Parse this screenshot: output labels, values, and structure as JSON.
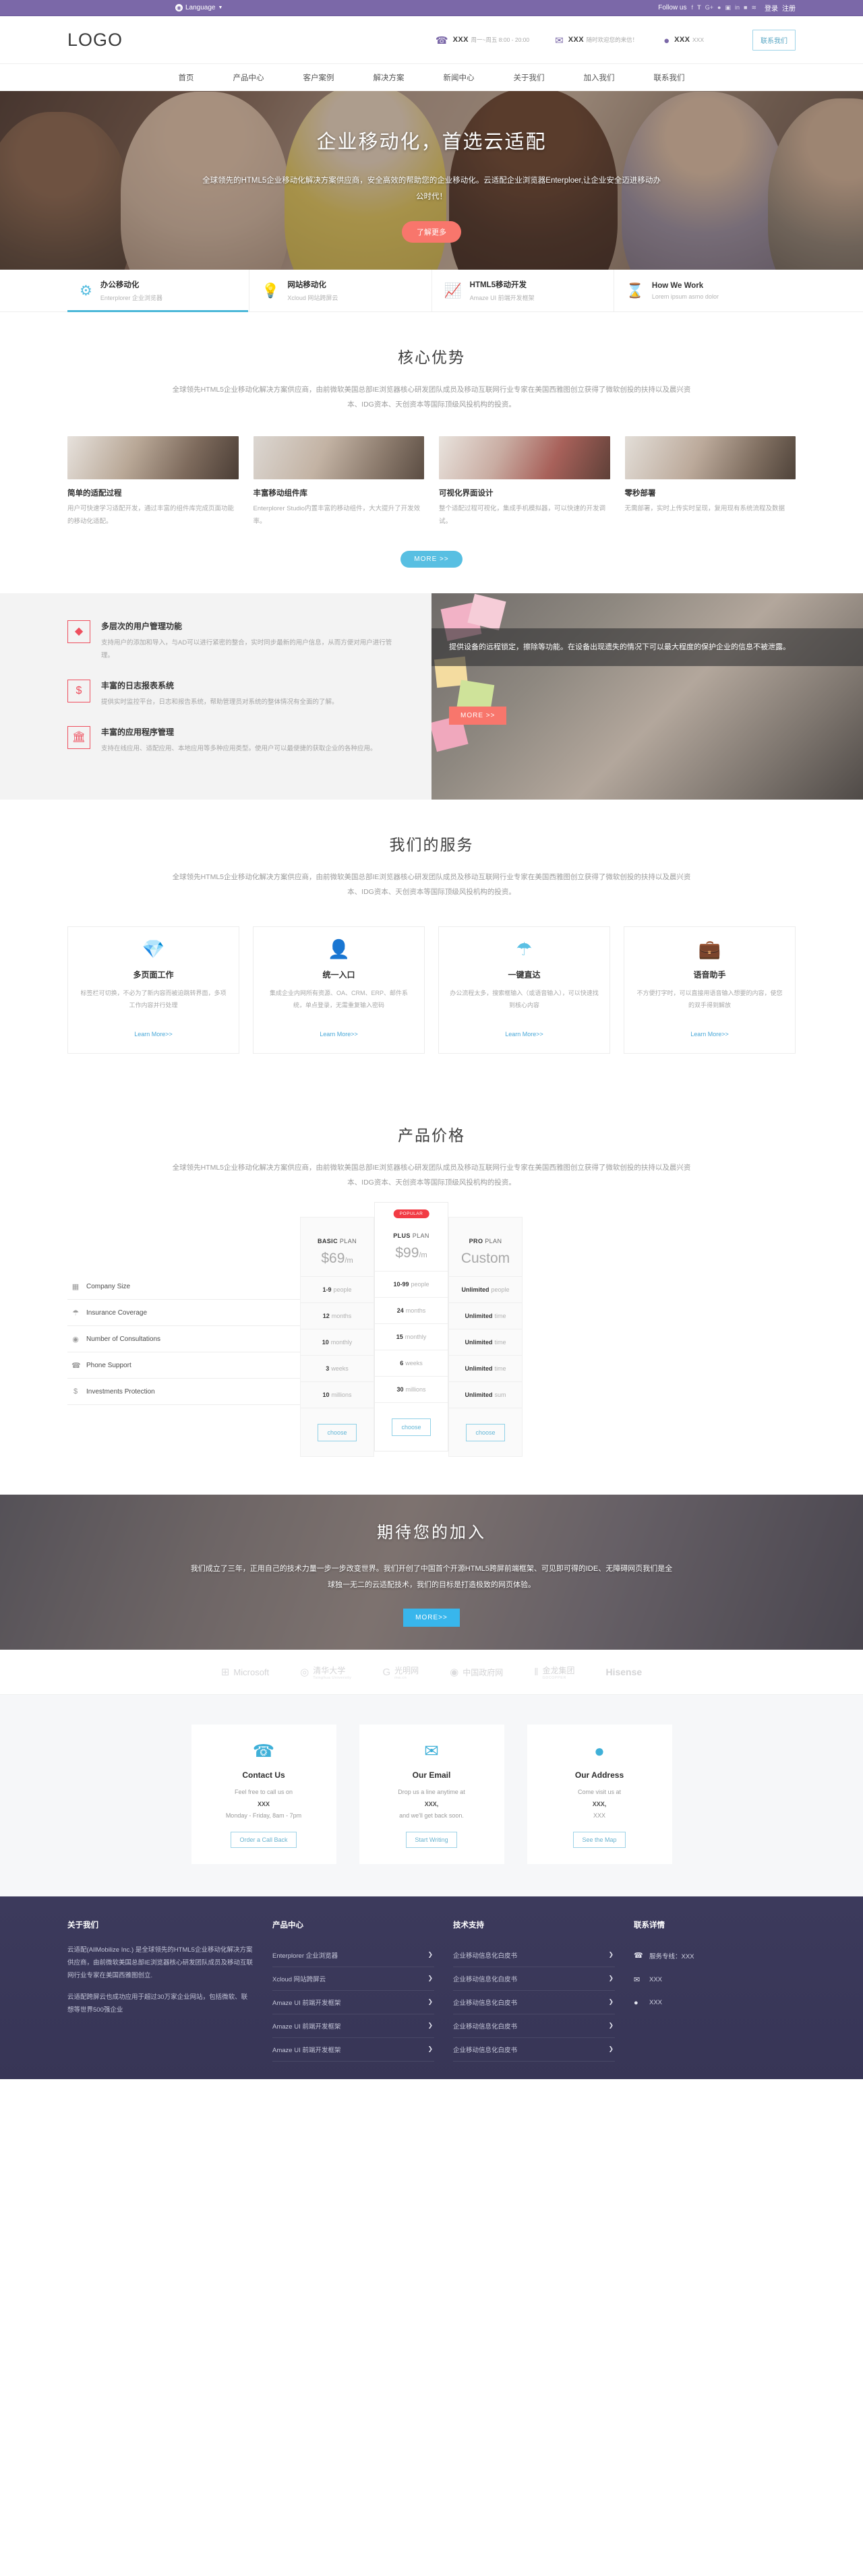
{
  "topbar": {
    "language_label": "Language",
    "globe_icon": "globe-icon",
    "follow_label": "Follow us",
    "socials": [
      "f",
      "𝐓",
      "G+",
      "●",
      "▣",
      "in",
      "■",
      "≋"
    ],
    "login_label": "登录",
    "register_label": "注册"
  },
  "header": {
    "logo": "LOGO",
    "contacts": [
      {
        "icon": "phone-icon",
        "title": "XXX",
        "sub": "周一~周五 8:00 - 20:00"
      },
      {
        "icon": "mail-icon",
        "title": "XXX",
        "sub": "随时欢迎您的来信！"
      },
      {
        "icon": "location-icon",
        "title": "XXX",
        "sub": "XXX"
      }
    ],
    "contact_button": "联系我们",
    "nav": [
      "首页",
      "产品中心",
      "客户案例",
      "解决方案",
      "新闻中心",
      "关于我们",
      "加入我们",
      "联系我们"
    ]
  },
  "hero": {
    "title": "企业移动化，首选云适配",
    "desc": "全球领先的HTML5企业移动化解决方案供应商，安全高效的帮助您的企业移动化。云适配企业浏览器Enterploer,让企业安全迈进移动办公时代！",
    "button": "了解更多"
  },
  "feature_tabs": [
    {
      "icon": "gear-icon",
      "title": "办公移动化",
      "sub": "Enterplorer 企业浏览器",
      "active": true
    },
    {
      "icon": "bulb-icon",
      "title": "网站移动化",
      "sub": "Xcloud 网站跨屏云",
      "active": false
    },
    {
      "icon": "chart-icon",
      "title": "HTML5移动开发",
      "sub": "Amaze UI 前端开发框架",
      "active": false
    },
    {
      "icon": "hourglass-icon",
      "title": "How We Work",
      "sub": "Lorem ipsum asmo dolor",
      "active": false
    }
  ],
  "core": {
    "title": "核心优势",
    "desc": "全球领先HTML5企业移动化解决方案供应商，由前微软美国总部IE浏览器核心研发团队成员及移动互联网行业专家在美国西雅图创立获得了微软创投的扶持以及晨兴资本、IDG资本、天创资本等国际顶级风投机构的投资。",
    "cards": [
      {
        "title": "简单的适配过程",
        "text": "用户可快速学习适配开发，通过丰富的组件库完成页面功能的移动化适配。"
      },
      {
        "title": "丰富移动组件库",
        "text": "Enterplorer Studio内置丰富的移动组件，大大提升了开发效率。"
      },
      {
        "title": "可视化界面设计",
        "text": "整个适配过程可视化，集成手机模拟器，可以快速的开发调试。"
      },
      {
        "title": "零秒部署",
        "text": "无需部署，实时上传实时呈现，复用现有系统流程及数据"
      }
    ],
    "more_button": "MORE  >>"
  },
  "split": {
    "features": [
      {
        "icon": "diamond-icon",
        "title": "多层次的用户管理功能",
        "text": "支持用户的添加和导入，与AD可以进行紧密的整合，实时同步最新的用户信息，从而方便对用户进行管理。"
      },
      {
        "icon": "dollar-icon",
        "title": "丰富的日志报表系统",
        "text": "提供实时监控平台，日志和报告系统，帮助管理员对系统的整体情况有全面的了解。"
      },
      {
        "icon": "bank-icon",
        "title": "丰富的应用程序管理",
        "text": "支持在线应用、适配应用、本地应用等多种应用类型。使用户可以最便捷的获取企业的各种应用。"
      }
    ],
    "panel_text": "提供设备的远程锁定，擦除等功能。在设备出现遗失的情况下可以最大程度的保护企业的信息不被泄露。",
    "more_button": "MORE  >>"
  },
  "services": {
    "title": "我们的服务",
    "desc": "全球领先HTML5企业移动化解决方案供应商，由前微软美国总部IE浏览器核心研发团队成员及移动互联网行业专家在美国西雅图创立获得了微软创投的扶持以及晨兴资本、IDG资本、天创资本等国际顶级风投机构的投资。",
    "cards": [
      {
        "icon": "diamond-icon",
        "title": "多页面工作",
        "text": "标签栏可切换，不必为了新内容而被迫跳转界面，多项工作内容并行处理",
        "link": "Learn More>>"
      },
      {
        "icon": "user-icon",
        "title": "统一入口",
        "text": "集成企业内网所有资源、OA、CRM、ERP、邮件系统，单点登录，无需重复输入密码",
        "link": "Learn More>>"
      },
      {
        "icon": "umbrella-icon",
        "title": "一键直达",
        "text": "办公流程太多，搜索框输入（或语音输入），可以快速找到核心内容",
        "link": "Learn More>>"
      },
      {
        "icon": "briefcase-icon",
        "title": "语音助手",
        "text": "不方便打字时，可以直接用语音输入想要的内容，使您的双手得到解放",
        "link": "Learn More>>"
      }
    ]
  },
  "pricing": {
    "title": "产品价格",
    "desc": "全球领先HTML5企业移动化解决方案供应商，由前微软美国总部IE浏览器核心研发团队成员及移动互联网行业专家在美国西雅图创立获得了微软创投的扶持以及晨兴资本、IDG资本、天创资本等国际顶级风投机构的投资。",
    "features": [
      {
        "icon": "building-icon",
        "label": "Company Size"
      },
      {
        "icon": "umbrella-icon",
        "label": "Insurance Coverage"
      },
      {
        "icon": "globe-icon",
        "label": "Number of Consultations"
      },
      {
        "icon": "phone-icon",
        "label": "Phone Support"
      },
      {
        "icon": "dollar-icon",
        "label": "Investments Protection"
      }
    ],
    "popular_badge": "POPULAR",
    "plans": [
      {
        "name_strong": "BASIC",
        "name_rest": " PLAN",
        "price": "$69",
        "per": "/m",
        "popular": false,
        "cells": [
          {
            "strong": "1-9",
            "rest": " people"
          },
          {
            "strong": "12",
            "rest": "months"
          },
          {
            "strong": "10",
            "rest": " monthly"
          },
          {
            "strong": "3",
            "rest": " weeks"
          },
          {
            "strong": "10",
            "rest": " millions"
          }
        ],
        "button": "choose"
      },
      {
        "name_strong": "PLUS",
        "name_rest": " PLAN",
        "price": "$99",
        "per": "/m",
        "popular": true,
        "cells": [
          {
            "strong": "10-99",
            "rest": " people"
          },
          {
            "strong": "24",
            "rest": "months"
          },
          {
            "strong": "15",
            "rest": " monthly"
          },
          {
            "strong": "6",
            "rest": " weeks"
          },
          {
            "strong": "30",
            "rest": " millions"
          }
        ],
        "button": "choose"
      },
      {
        "name_strong": "PRO",
        "name_rest": " PLAN",
        "price": "Custom",
        "per": "",
        "popular": false,
        "cells": [
          {
            "strong": "Unlimited",
            "rest": " people"
          },
          {
            "strong": "Unlimited",
            "rest": " time"
          },
          {
            "strong": "Unlimited",
            "rest": " time"
          },
          {
            "strong": "Unlimited",
            "rest": " time"
          },
          {
            "strong": "Unlimited",
            "rest": " sum"
          }
        ],
        "button": "choose"
      }
    ]
  },
  "join": {
    "title": "期待您的加入",
    "desc": "我们成立了三年，正用自己的技术力量一步一步改变世界。我们开创了中国首个开源HTML5跨屏前端框架、可见即可得的IDE、无障碍网页我们是全球独一无二的云适配技术，我们的目标是打造极致的网页体验。",
    "button": "MORE>>"
  },
  "partners": [
    {
      "name": "Microsoft",
      "mark": "⊞",
      "sub": ""
    },
    {
      "name": "清华大学",
      "mark": "◎",
      "sub": "Tsinghua University"
    },
    {
      "name": "光明网",
      "mark": "G",
      "sub": "mw.cn"
    },
    {
      "name": "中国政府网",
      "mark": "◉",
      "sub": ""
    },
    {
      "name": "金龙集团",
      "mark": "‖",
      "sub": "GDCOPPER"
    },
    {
      "name": "Hisense",
      "mark": "",
      "sub": ""
    }
  ],
  "contact_cards": [
    {
      "icon": "phone-icon",
      "title": "Contact Us",
      "line1": "Feel free to call us on",
      "line2": "XXX",
      "line3": "Monday - Friday, 8am - 7pm",
      "button": "Order a Call Back"
    },
    {
      "icon": "mail-icon",
      "title": "Our Email",
      "line1": "Drop us a line anytime at",
      "line2": "XXX,",
      "line3": "and we'll get back soon.",
      "button": "Start Writing"
    },
    {
      "icon": "location-icon",
      "title": "Our Address",
      "line1": "Come visit us at",
      "line2": "XXX,",
      "line3": "XXX",
      "button": "See the Map"
    }
  ],
  "footer": {
    "about": {
      "title": "关于我们",
      "p1": "云适配(AllMobilize Inc.) 是全球领先的HTML5企业移动化解决方案供应商，由前微软美国总部IE浏览器核心研发团队成员及移动互联网行业专家在美国西雅图创立.",
      "p2": "云适配跨屏云也成功应用于超过30万家企业网站，包括微软、联想等世界500强企业"
    },
    "products": {
      "title": "产品中心",
      "items": [
        "Enterplorer 企业浏览器",
        "Xcloud 网站跨屏云",
        "Amaze UI 前端开发框架",
        "Amaze UI 前端开发框架",
        "Amaze UI 前端开发框架"
      ]
    },
    "support": {
      "title": "技术支持",
      "items": [
        "企业移动信息化白皮书",
        "企业移动信息化白皮书",
        "企业移动信息化白皮书",
        "企业移动信息化白皮书",
        "企业移动信息化白皮书"
      ]
    },
    "contact": {
      "title": "联系详情",
      "items": [
        {
          "icon": "phone-icon",
          "text": "服务专线：XXX"
        },
        {
          "icon": "mail-icon",
          "text": "XXX"
        },
        {
          "icon": "location-icon",
          "text": "XXX"
        }
      ]
    }
  }
}
